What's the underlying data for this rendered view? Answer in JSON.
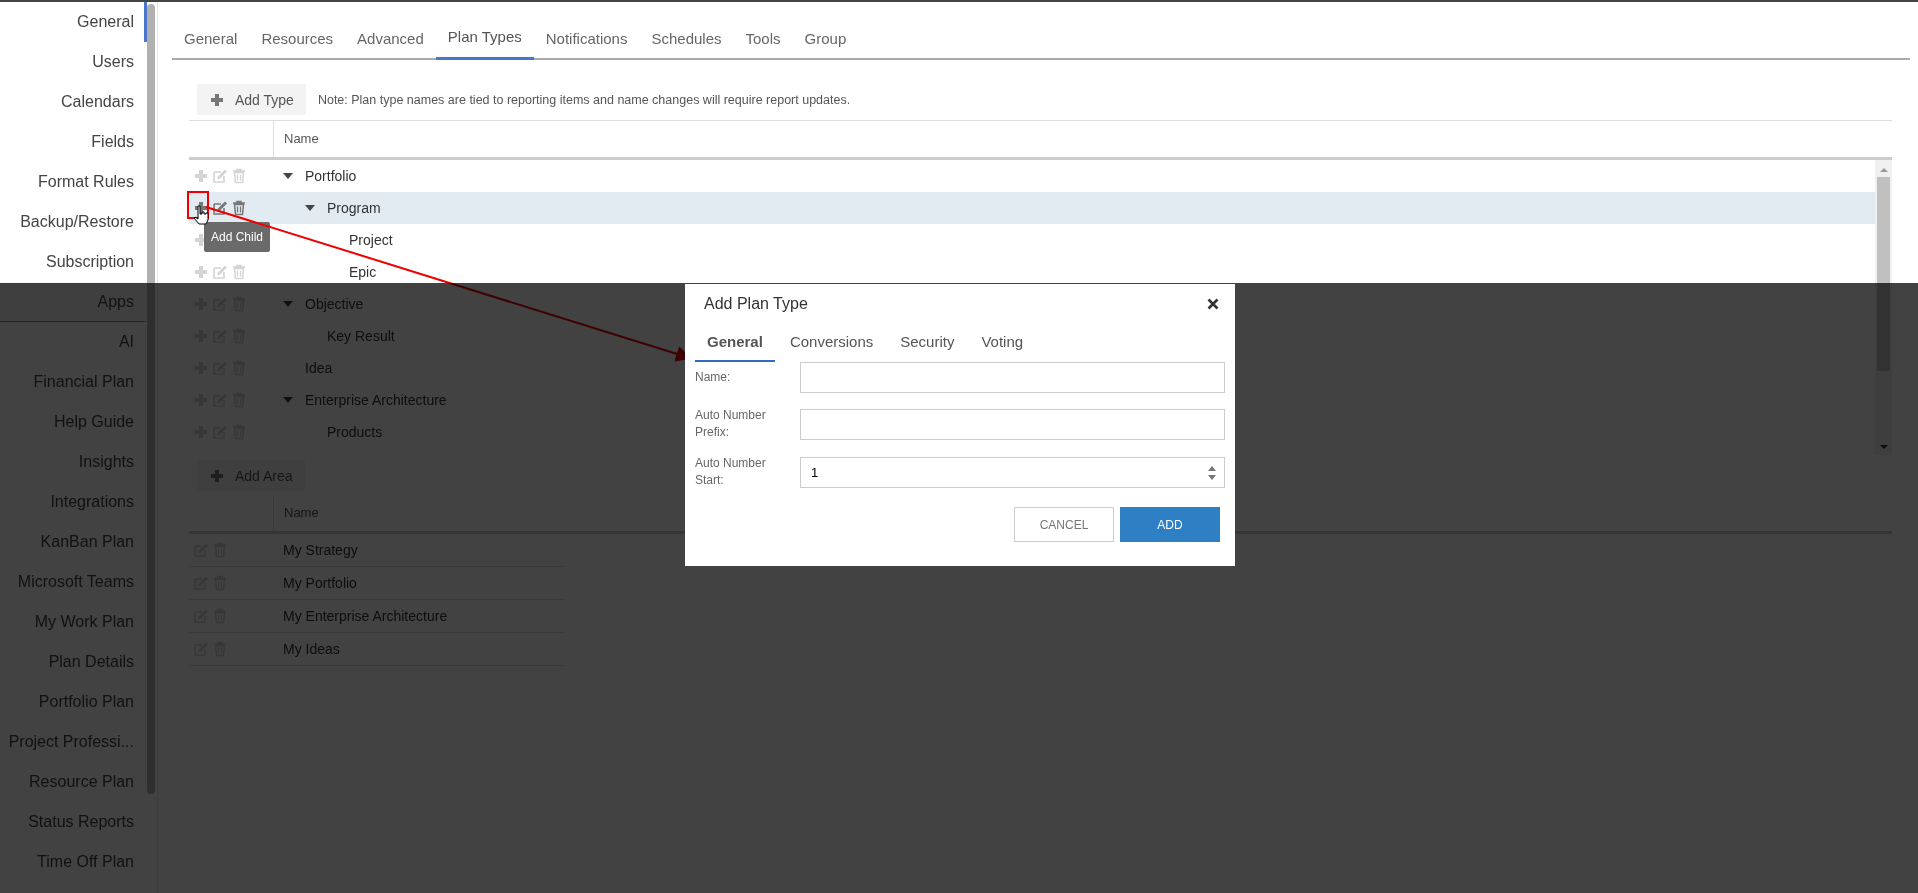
{
  "sidebar": {
    "items": [
      {
        "label": "General",
        "kind": "item",
        "selected": true
      },
      {
        "label": "Users",
        "kind": "item",
        "selected": false
      },
      {
        "label": "Calendars",
        "kind": "item",
        "selected": false
      },
      {
        "label": "Fields",
        "kind": "item",
        "selected": false
      },
      {
        "label": "Format Rules",
        "kind": "item",
        "selected": false
      },
      {
        "label": "Backup/Restore",
        "kind": "item",
        "selected": false
      },
      {
        "label": "Subscription",
        "kind": "item",
        "selected": false
      },
      {
        "label": "Apps",
        "kind": "header"
      },
      {
        "label": "AI",
        "kind": "item",
        "selected": false
      },
      {
        "label": "Financial Plan",
        "kind": "item",
        "selected": false
      },
      {
        "label": "Help Guide",
        "kind": "item",
        "selected": false
      },
      {
        "label": "Insights",
        "kind": "item",
        "selected": false
      },
      {
        "label": "Integrations",
        "kind": "item",
        "selected": false
      },
      {
        "label": "KanBan Plan",
        "kind": "item",
        "selected": false
      },
      {
        "label": "Microsoft Teams",
        "kind": "item",
        "selected": false
      },
      {
        "label": "My Work Plan",
        "kind": "item",
        "selected": false
      },
      {
        "label": "Plan Details",
        "kind": "item",
        "selected": false
      },
      {
        "label": "Portfolio Plan",
        "kind": "item",
        "selected": false
      },
      {
        "label": "Project Professi...",
        "kind": "item",
        "selected": false
      },
      {
        "label": "Resource Plan",
        "kind": "item",
        "selected": false
      },
      {
        "label": "Status Reports",
        "kind": "item",
        "selected": false
      },
      {
        "label": "Time Off Plan",
        "kind": "item",
        "selected": false
      }
    ]
  },
  "tabs": [
    {
      "label": "General",
      "selected": false
    },
    {
      "label": "Resources",
      "selected": false
    },
    {
      "label": "Advanced",
      "selected": false
    },
    {
      "label": "Plan Types",
      "selected": true
    },
    {
      "label": "Notifications",
      "selected": false
    },
    {
      "label": "Schedules",
      "selected": false
    },
    {
      "label": "Tools",
      "selected": false
    },
    {
      "label": "Group",
      "selected": false
    }
  ],
  "add_type_button": "Add Type",
  "note": "Note: Plan type names are tied to reporting items and name changes will require report updates.",
  "plan_types_grid": {
    "columns": [
      "Name"
    ],
    "rows": [
      {
        "name": "Portfolio",
        "expanded": true,
        "selected": false,
        "children": [
          {
            "name": "Program",
            "expanded": true,
            "selected": true,
            "children": [
              {
                "name": "Project",
                "selected": false
              },
              {
                "name": "Epic",
                "selected": false
              }
            ]
          }
        ]
      },
      {
        "name": "Objective",
        "expanded": true,
        "selected": false,
        "children": [
          {
            "name": "Key Result",
            "selected": false
          }
        ]
      },
      {
        "name": "Idea",
        "selected": false
      },
      {
        "name": "Enterprise Architecture",
        "expanded": true,
        "selected": false,
        "children": [
          {
            "name": "Products",
            "selected": false
          }
        ]
      }
    ]
  },
  "tooltip": "Add Child",
  "add_area_button": "Add Area",
  "areas_grid": {
    "columns": [
      "Name"
    ],
    "rows": [
      {
        "name": "My Strategy"
      },
      {
        "name": "My Portfolio"
      },
      {
        "name": "My Enterprise Architecture"
      },
      {
        "name": "My Ideas"
      }
    ]
  },
  "dialog": {
    "title": "Add Plan Type",
    "tabs": [
      {
        "label": "General",
        "selected": true
      },
      {
        "label": "Conversions",
        "selected": false
      },
      {
        "label": "Security",
        "selected": false
      },
      {
        "label": "Voting",
        "selected": false
      }
    ],
    "fields": [
      {
        "label": "Name:",
        "kind": "text"
      },
      {
        "label": "Auto Number Prefix:",
        "kind": "text"
      },
      {
        "label": "Auto Number Start:",
        "kind": "number",
        "value": "1"
      }
    ],
    "buttons": [
      {
        "label": "CANCEL",
        "kind": "secondary"
      },
      {
        "label": "ADD",
        "kind": "primary"
      }
    ]
  }
}
